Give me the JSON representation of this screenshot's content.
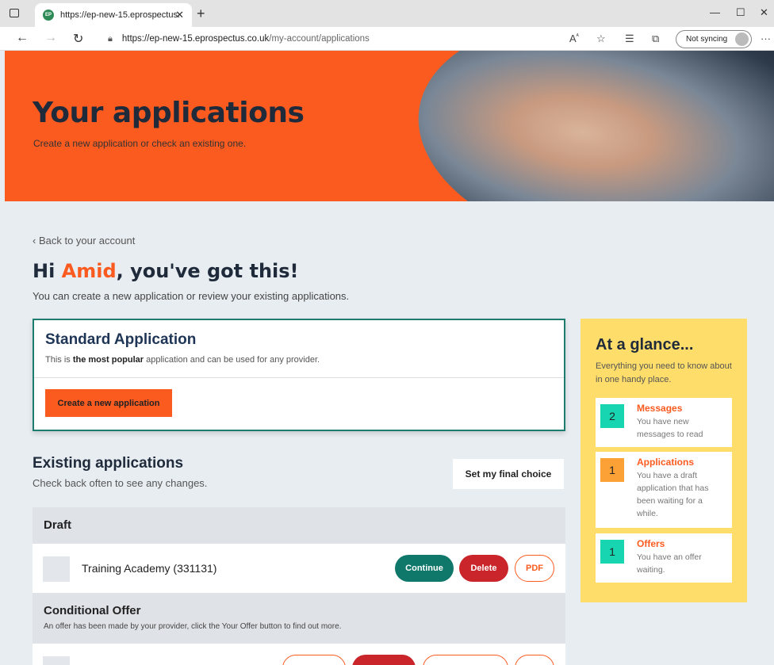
{
  "browser": {
    "tab_title": "https://ep-new-15.eprospectus.c",
    "favicon_text": "EP",
    "url_host": "https://ep-new-15.eprospectus.co.uk",
    "url_path": "/my-account/applications",
    "sync_label": "Not syncing"
  },
  "hero": {
    "title": "Your applications",
    "subtitle": "Create a new application or check an existing one."
  },
  "back_link": "‹ Back to your account",
  "greeting": {
    "prefix": "Hi ",
    "name": "Amid",
    "suffix": ", you've got this!",
    "subtitle": "You can create a new application or review your existing applications."
  },
  "standard": {
    "title": "Standard Application",
    "desc_prefix": "This is ",
    "desc_bold": "the most popular",
    "desc_suffix": " application and can be used for any provider.",
    "button": "Create a new application"
  },
  "existing": {
    "title": "Existing applications",
    "subtitle": "Check back often to see any changes.",
    "final_choice_button": "Set my final choice"
  },
  "groups": {
    "draft": {
      "title": "Draft"
    },
    "conditional": {
      "title": "Conditional Offer",
      "desc": "An offer has been made by your provider, click the Your Offer button to find out more."
    }
  },
  "draft_row": {
    "name": "Training Academy (331131)",
    "continue": "Continue",
    "delete": "Delete",
    "pdf": "PDF"
  },
  "glance": {
    "title": "At a glance...",
    "subtitle": "Everything you need to know about in one handy place.",
    "items": [
      {
        "count": "2",
        "title": "Messages",
        "text": "You have new messages to read",
        "color": "#17d5b0"
      },
      {
        "count": "1",
        "title": "Applications",
        "text": "You have a draft application that has been waiting for a while.",
        "color": "#fba136"
      },
      {
        "count": "1",
        "title": "Offers",
        "text": "You have an offer waiting.",
        "color": "#17d5b0"
      }
    ]
  },
  "colors": {
    "accent": "#fb5b1f",
    "teal": "#10776b",
    "danger": "#c9252b",
    "glance_bg": "#fedd6a"
  }
}
